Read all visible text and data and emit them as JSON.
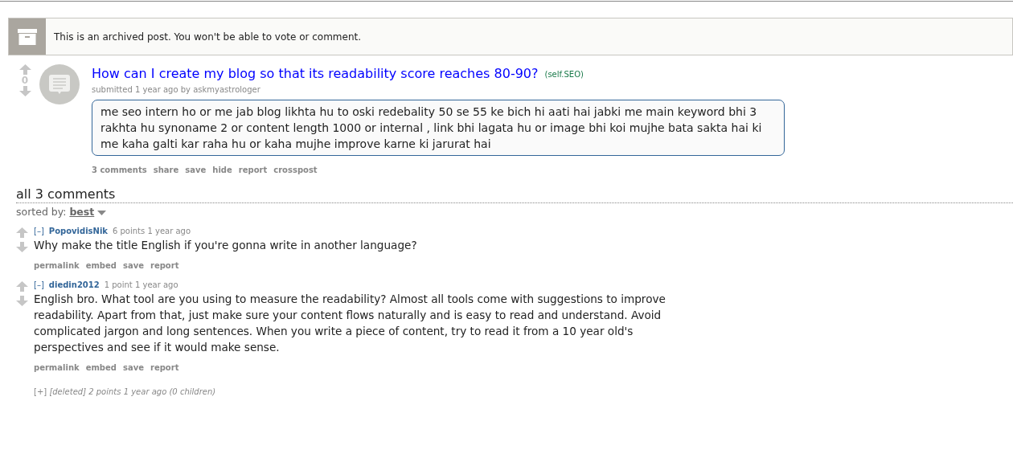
{
  "banner": {
    "text": "This is an archived post. You won't be able to vote or comment."
  },
  "post": {
    "score": "0",
    "title": "How can I create my blog so that its readability score reaches 80-90?",
    "domain": "(self.SEO)",
    "tagline_prefix": "submitted 1 year ago by",
    "author": "askmyastrologer",
    "body": "me seo intern ho or me jab blog likhta hu to oski redebality 50 se 55 ke bich hi aati hai jabki me main keyword bhi 3 rakhta hu synoname 2 or content length 1000 or internal , link bhi lagata hu or image bhi koi mujhe bata sakta hai ki me kaha galti kar raha hu or kaha mujhe improve karne ki jarurat hai",
    "actions": [
      "3 comments",
      "share",
      "save",
      "hide",
      "report",
      "crosspost"
    ]
  },
  "comments_header": {
    "title": "all 3 comments",
    "sort_label": "sorted by:",
    "sort_value": "best"
  },
  "comments": [
    {
      "kind": "comment",
      "toggle": "[–]",
      "author": "PopovidisNik",
      "meta": "6 points 1 year ago",
      "body": "Why make the title English if you're gonna write in another language?",
      "actions": [
        "permalink",
        "embed",
        "save",
        "report"
      ]
    },
    {
      "kind": "comment",
      "toggle": "[–]",
      "author": "diedin2012",
      "meta": "1 point 1 year ago",
      "body": "English bro. What tool are you using to measure the readability? Almost all tools come with suggestions to improve readability. Apart from that, just make sure your content flows naturally and is easy to read and understand. Avoid complicated jargon and long sentences. When you write a piece of content, try to read it from a 10 year old's perspectives and see if it would make sense.",
      "actions": [
        "permalink",
        "embed",
        "save",
        "report"
      ]
    },
    {
      "kind": "collapsed",
      "toggle": "[+]",
      "meta": "[deleted] 2 points 1 year ago (0 children)"
    }
  ]
}
